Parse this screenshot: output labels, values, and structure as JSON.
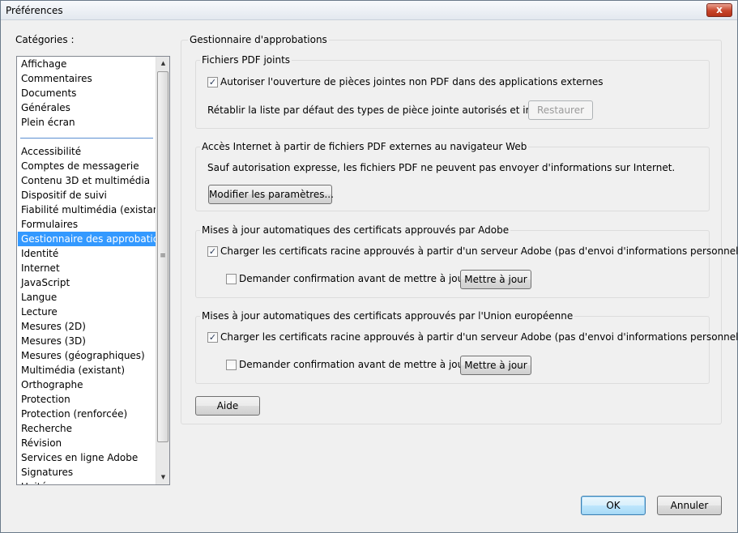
{
  "window": {
    "title": "Préférences",
    "close_symbol": "x"
  },
  "categories": {
    "label": "Catégories :",
    "group_top": [
      "Affichage",
      "Commentaires",
      "Documents",
      "Générales",
      "Plein écran"
    ],
    "group_bottom": [
      "Accessibilité",
      "Comptes de messagerie",
      "Contenu 3D et multimédia",
      "Dispositif de suivi",
      "Fiabilité multimédia (existant)",
      "Formulaires",
      "Gestionnaire des approbations",
      "Identité",
      "Internet",
      "JavaScript",
      "Langue",
      "Lecture",
      "Mesures (2D)",
      "Mesures (3D)",
      "Mesures (géographiques)",
      "Multimédia (existant)",
      "Orthographe",
      "Protection",
      "Protection (renforcée)",
      "Recherche",
      "Révision",
      "Services en ligne Adobe",
      "Signatures",
      "Unités"
    ],
    "selected": "Gestionnaire des approbations"
  },
  "main": {
    "title": "Gestionnaire d'approbations",
    "pdf_attachments": {
      "title": "Fichiers PDF joints",
      "allow_label": "Autoriser l'ouverture de pièces jointes non PDF dans des applications externes",
      "allow_checked": true,
      "restore_label": "Rétablir la liste par défaut des types de pièce jointe autorisés et interdits :",
      "restore_button": "Restaurer"
    },
    "internet_access": {
      "title": "Accès Internet à partir de fichiers PDF externes au navigateur Web",
      "description": "Sauf autorisation expresse, les fichiers PDF ne peuvent pas envoyer d'informations sur Internet.",
      "settings_button": "Modifier les paramètres..."
    },
    "adobe_certs": {
      "title": "Mises à jour automatiques des certificats approuvés par Adobe",
      "load_label": "Charger les certificats racine approuvés à partir d'un serveur Adobe (pas d'envoi d'informations personnelles)",
      "load_checked": true,
      "confirm_label": "Demander confirmation avant de mettre à jour",
      "confirm_checked": false,
      "update_button": "Mettre à jour"
    },
    "eu_certs": {
      "title": "Mises à jour automatiques des certificats approuvés par l'Union européenne",
      "load_label": "Charger les certificats racine approuvés à partir d'un serveur Adobe (pas d'envoi d'informations personnelles)",
      "load_checked": true,
      "confirm_label": "Demander confirmation avant de mettre à jour",
      "confirm_checked": false,
      "update_button": "Mettre à jour"
    },
    "help_button": "Aide"
  },
  "footer": {
    "ok_button": "OK",
    "cancel_button": "Annuler"
  },
  "icons": {
    "check": "✓",
    "scroll_up": "▲",
    "scroll_down": "▼",
    "grip": "≡"
  }
}
